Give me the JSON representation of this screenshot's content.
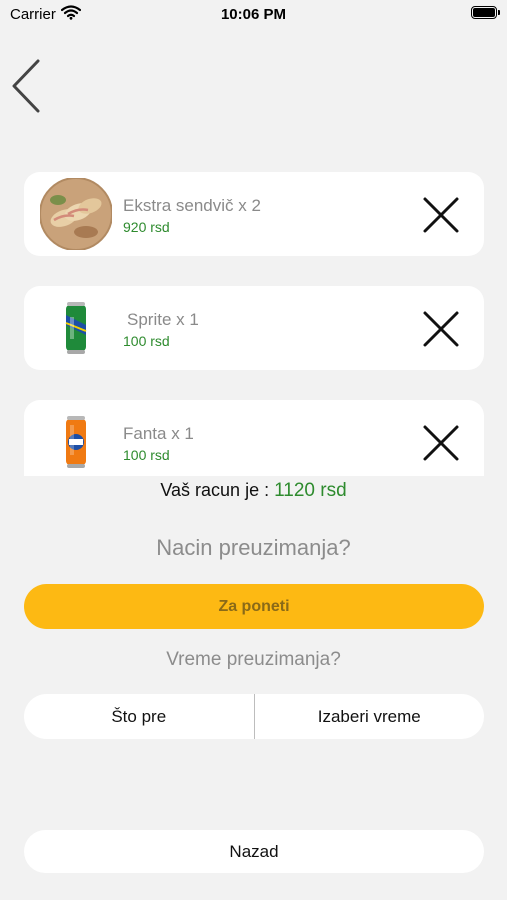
{
  "status_bar": {
    "carrier": "Carrier",
    "time": "10:06 PM",
    "wifi_icon": "wifi-icon",
    "battery_icon": "battery-icon"
  },
  "nav": {
    "back_icon": "chevron-left-icon"
  },
  "cart": {
    "items": [
      {
        "name": "Ekstra sendvič x 2",
        "price": "920 rsd",
        "image": "sandwich-image",
        "remove_icon": "close-icon"
      },
      {
        "name": "Sprite x 1",
        "price": "100 rsd",
        "image": "sprite-can-image",
        "remove_icon": "close-icon"
      },
      {
        "name": "Fanta x 1",
        "price": "100 rsd",
        "image": "fanta-can-image",
        "remove_icon": "close-icon"
      }
    ]
  },
  "total": {
    "label": "Vaš racun je :",
    "amount": "1120 rsd"
  },
  "pickup_method": {
    "question": "Nacin preuzimanja?",
    "selected": "Za poneti"
  },
  "pickup_time": {
    "question": "Vreme preuzimanja?",
    "options": [
      "Što pre",
      "Izaberi vreme"
    ]
  },
  "footer": {
    "back_label": "Nazad"
  },
  "colors": {
    "accent": "#fdb913",
    "price": "#2e8b2e",
    "background": "#f2f2f2"
  }
}
